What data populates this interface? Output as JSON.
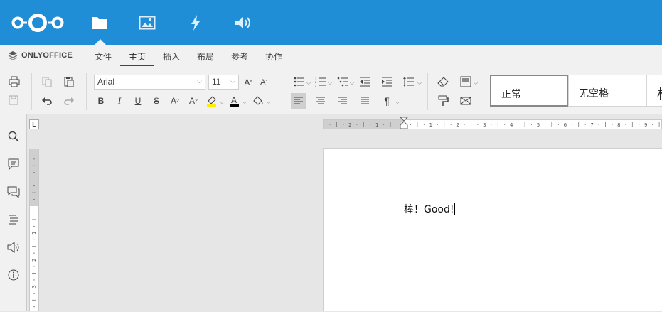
{
  "nextcloud": {
    "apps": [
      {
        "icon": "files-icon",
        "active": true
      },
      {
        "icon": "photos-icon",
        "active": false
      },
      {
        "icon": "activity-icon",
        "active": false
      },
      {
        "icon": "audio-icon",
        "active": false
      }
    ],
    "colors": {
      "header": "#1f8ed6"
    }
  },
  "editor": {
    "brand": "ONLYOFFICE",
    "tabs": [
      "文件",
      "主页",
      "插入",
      "布局",
      "参考",
      "协作"
    ],
    "active_tab": "主页",
    "font_name": "Arial",
    "font_size": "11",
    "styles": [
      "正常",
      "无空格",
      "标"
    ],
    "document_text": "棒！Good!"
  }
}
